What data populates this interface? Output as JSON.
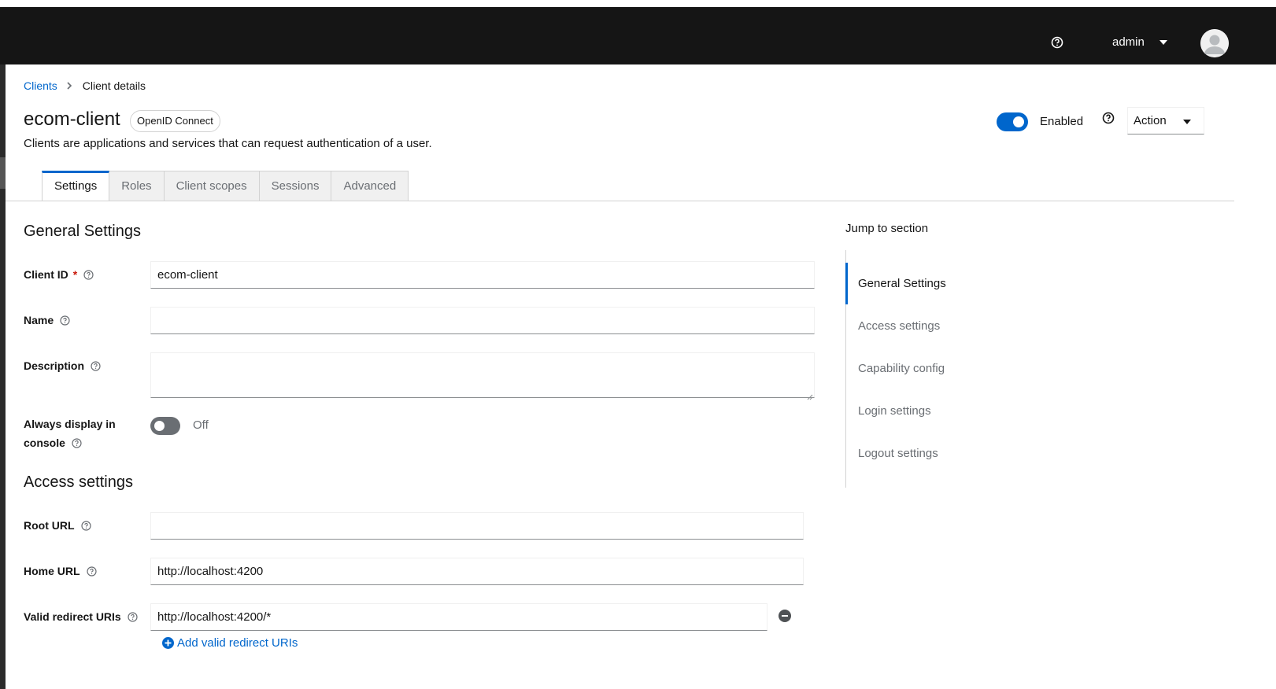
{
  "header": {
    "user_name": "admin",
    "help_icon": "help-circle-icon",
    "avatar_icon": "user-avatar-icon"
  },
  "breadcrumb": {
    "items": [
      "Clients",
      "Client details"
    ]
  },
  "client": {
    "title": "ecom-client",
    "protocol_badge": "OpenID Connect",
    "description": "Clients are applications and services that can request authentication of a user.",
    "enabled_label": "Enabled",
    "enabled": true,
    "action_label": "Action"
  },
  "tabs": [
    {
      "label": "Settings",
      "active": true
    },
    {
      "label": "Roles",
      "active": false
    },
    {
      "label": "Client scopes",
      "active": false
    },
    {
      "label": "Sessions",
      "active": false
    },
    {
      "label": "Advanced",
      "active": false
    }
  ],
  "general": {
    "title": "General Settings",
    "client_id_label": "Client ID",
    "client_id_required": "*",
    "client_id_value": "ecom-client",
    "name_label": "Name",
    "name_value": "",
    "description_label": "Description",
    "description_value": "",
    "always_display_label_line1": "Always display in",
    "always_display_label_line2": "console",
    "always_display_state": "Off"
  },
  "access": {
    "title": "Access settings",
    "root_url_label": "Root URL",
    "root_url_value": "",
    "home_url_label": "Home URL",
    "home_url_value": "http://localhost:4200",
    "redirect_label": "Valid redirect URIs",
    "redirect_value": "http://localhost:4200/*",
    "add_redirect_label": "Add valid redirect URIs"
  },
  "jump": {
    "title": "Jump to section",
    "items": [
      "General Settings",
      "Access settings",
      "Capability config",
      "Login settings",
      "Logout settings"
    ],
    "active_index": 0
  },
  "colors": {
    "masthead": "#151515",
    "accent": "#0066cc",
    "required": "#c9190b"
  }
}
